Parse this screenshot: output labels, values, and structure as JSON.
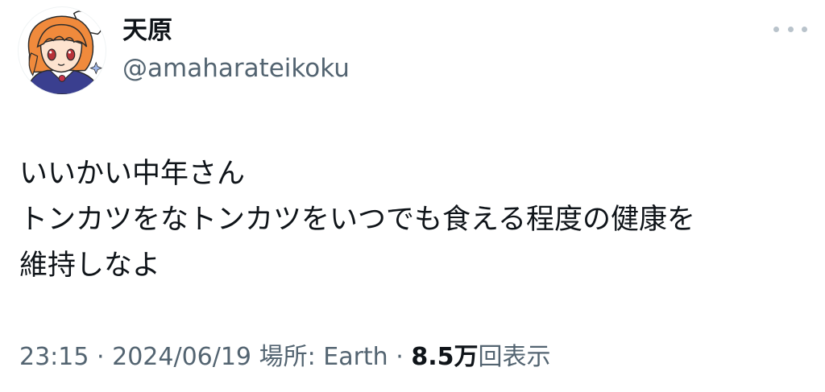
{
  "user": {
    "display_name": "天原",
    "handle": "@amaharateikoku",
    "avatar_icon": "anime-avatar-orange-hair-maid"
  },
  "menu": {
    "icon": "more-horizontal-icon"
  },
  "tweet": {
    "lines": [
      "いいかい中年さん",
      "トンカツをなトンカツをいつでも食える程度の健康を",
      "維持しなよ"
    ]
  },
  "meta": {
    "time": "23:15",
    "separator": "·",
    "date": "2024/06/19",
    "location_label": "場所:",
    "location": "Earth",
    "views_count": "8.5万",
    "views_label": "回表示"
  },
  "colors": {
    "text_primary": "#0f1419",
    "text_secondary": "#536471",
    "hair": "#f08a3c",
    "uniform": "#3a3f8f"
  }
}
